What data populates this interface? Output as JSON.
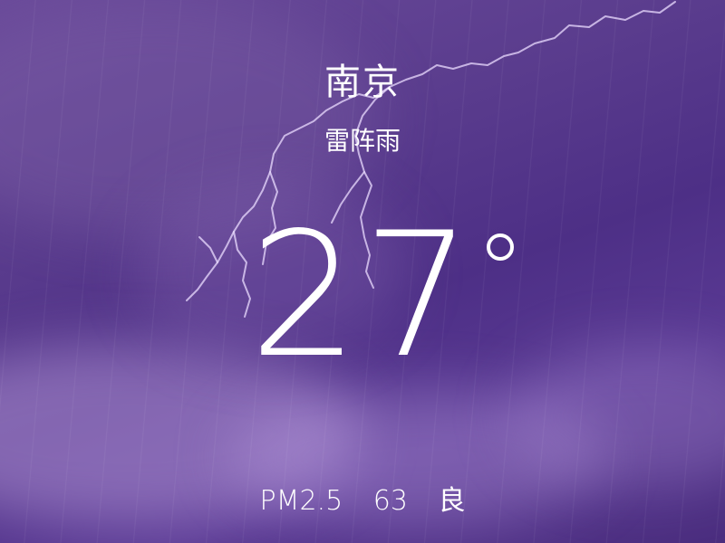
{
  "weather": {
    "city": "南京",
    "condition": "雷阵雨",
    "temperature": "27",
    "degree_symbol": "°"
  },
  "air_quality": {
    "label": "PM2.5",
    "value": "63",
    "level": "良"
  },
  "colors": {
    "background_primary": "#5b3d8e",
    "text": "#ffffff"
  }
}
